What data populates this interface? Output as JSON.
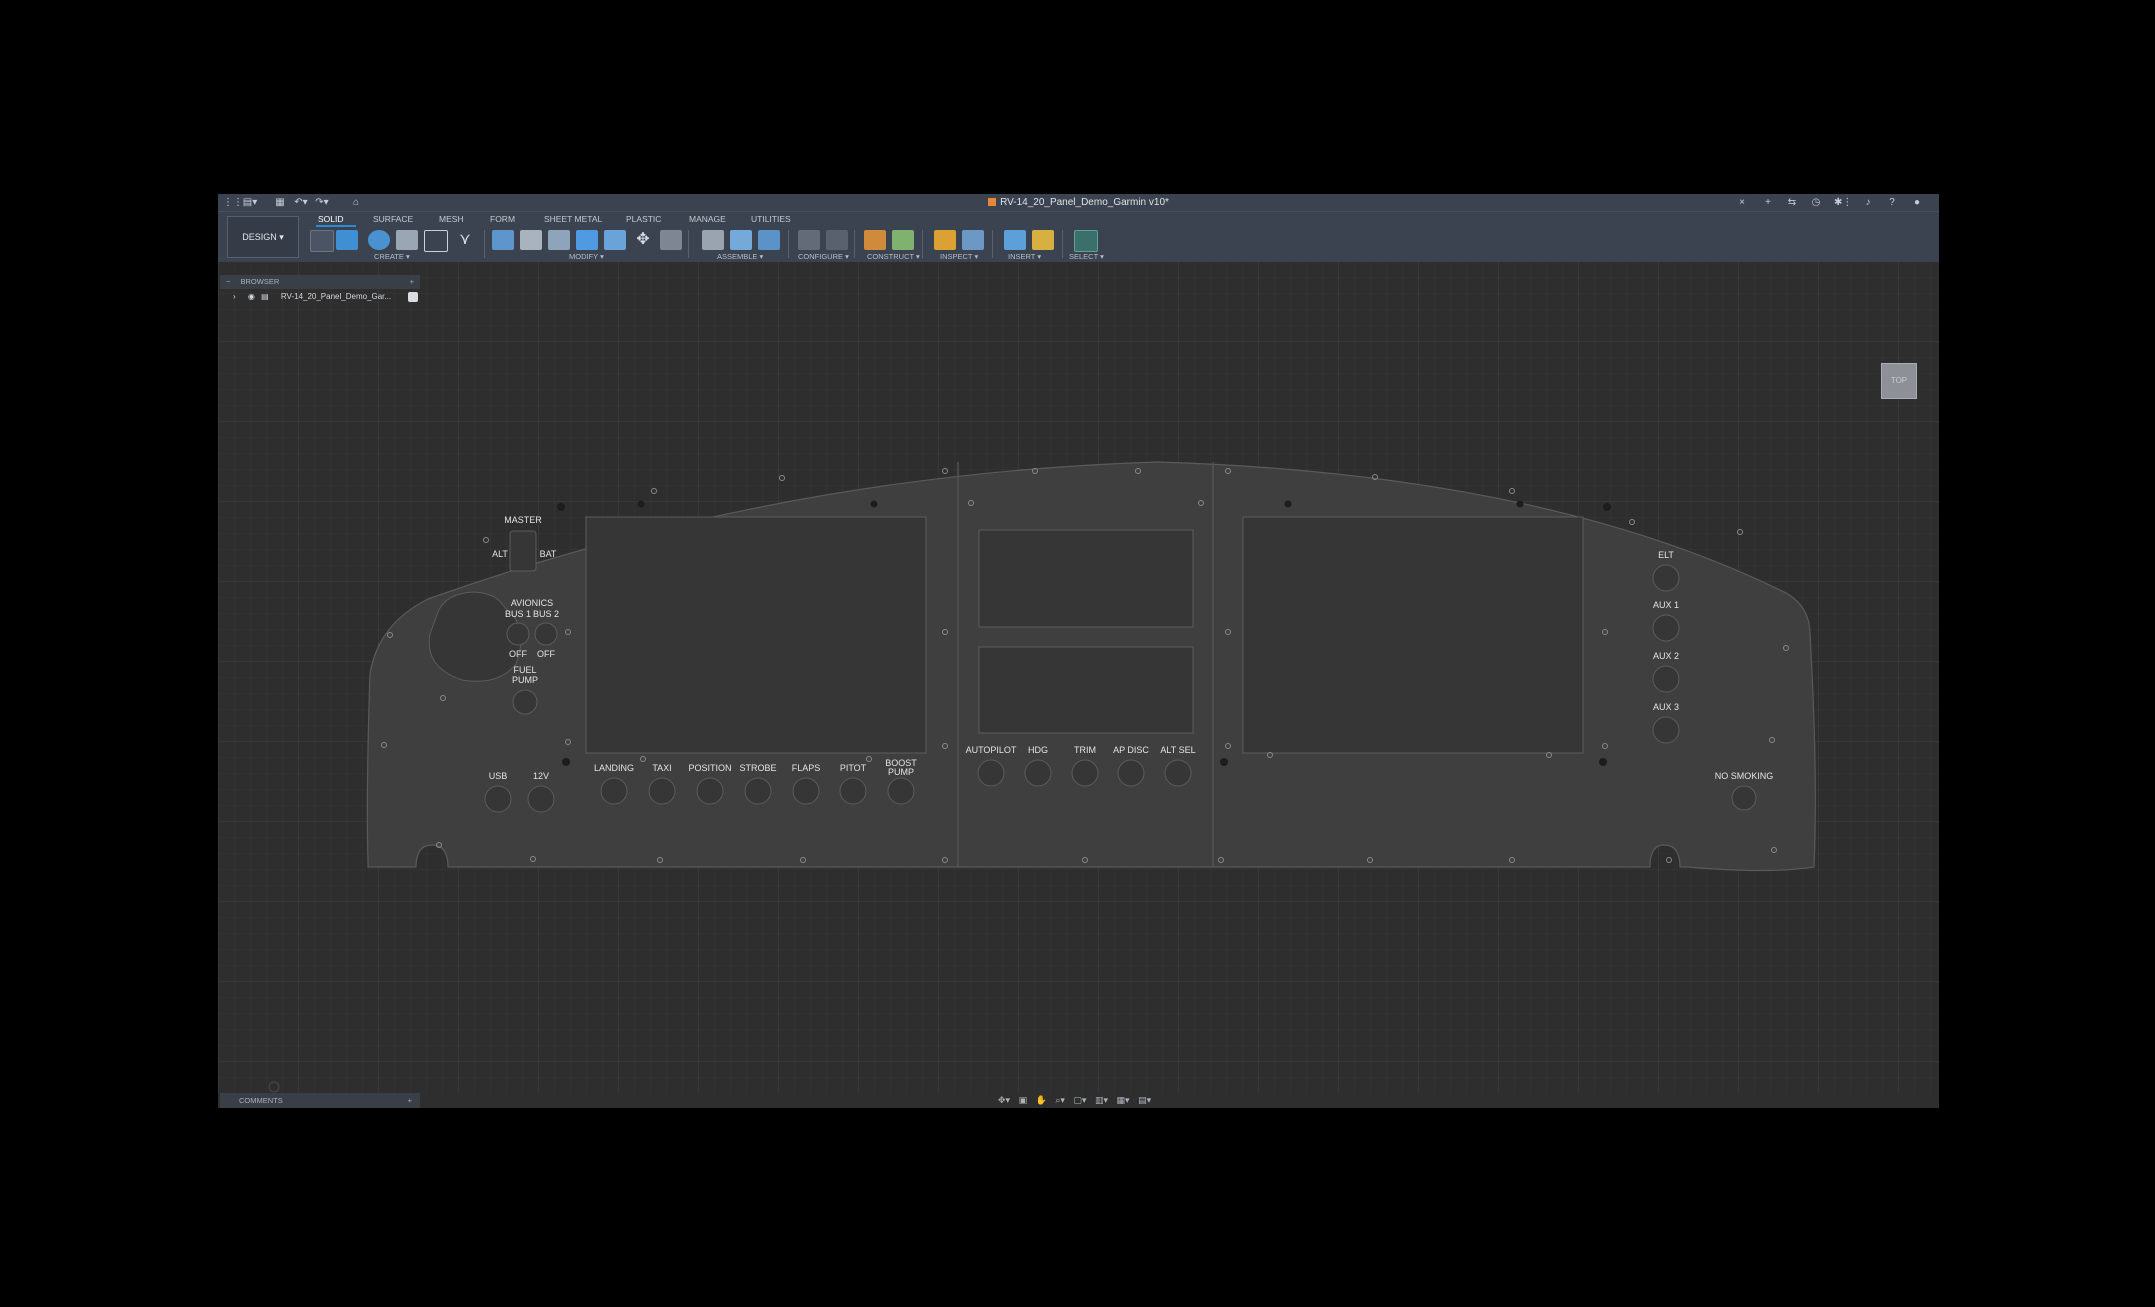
{
  "window": {
    "title": "RV-14_20_Panel_Demo_Garmin v10*",
    "left_icons": [
      "grid-icon",
      "file-icon",
      "save-icon",
      "undo-icon",
      "redo-icon",
      "home-icon"
    ],
    "right_icons": [
      "close-icon",
      "plus-icon",
      "share-icon",
      "clock-icon",
      "extensions-icon",
      "bell-icon",
      "help-icon",
      "user-icon"
    ]
  },
  "toolbar": {
    "workspace": "DESIGN ▾",
    "tabs": [
      "SOLID",
      "SURFACE",
      "MESH",
      "FORM",
      "SHEET METAL",
      "PLASTIC",
      "MANAGE",
      "UTILITIES"
    ],
    "active_tab": "SOLID",
    "groups": [
      "CREATE ▾",
      "MODIFY ▾",
      "ASSEMBLE ▾",
      "CONFIGURE ▾",
      "CONSTRUCT ▾",
      "INSPECT ▾",
      "INSERT ▾",
      "SELECT ▾"
    ]
  },
  "browser": {
    "header": "BROWSER",
    "item": "RV-14_20_Panel_Demo_Gar..."
  },
  "viewcube": {
    "label": "TOP"
  },
  "comments": {
    "label": "COMMENTS"
  },
  "panel": {
    "left": {
      "master": "MASTER",
      "alt": "ALT",
      "bat": "BAT",
      "avionics": "AVIONICS",
      "bus1": "BUS 1",
      "bus2": "BUS 2",
      "off1": "OFF",
      "off2": "OFF",
      "fuel_pump_1": "FUEL",
      "fuel_pump_2": "PUMP",
      "usb": "USB",
      "v12": "12V"
    },
    "bottom_switches": [
      "LANDING",
      "TAXI",
      "POSITION",
      "STROBE",
      "FLAPS",
      "PITOT",
      "BOOST"
    ],
    "boost_line2": "PUMP",
    "center_switches": [
      "AUTOPILOT",
      "HDG",
      "TRIM",
      "AP DISC",
      "ALT SEL"
    ],
    "right_switches": [
      "ELT",
      "AUX 1",
      "AUX 2",
      "AUX 3"
    ],
    "no_smoking": "NO SMOKING"
  },
  "colors": {
    "accent": "#2a8cd8",
    "panel": "#3f3f3f",
    "canvas": "#2e2e2e",
    "toolbar": "#3b4350"
  }
}
